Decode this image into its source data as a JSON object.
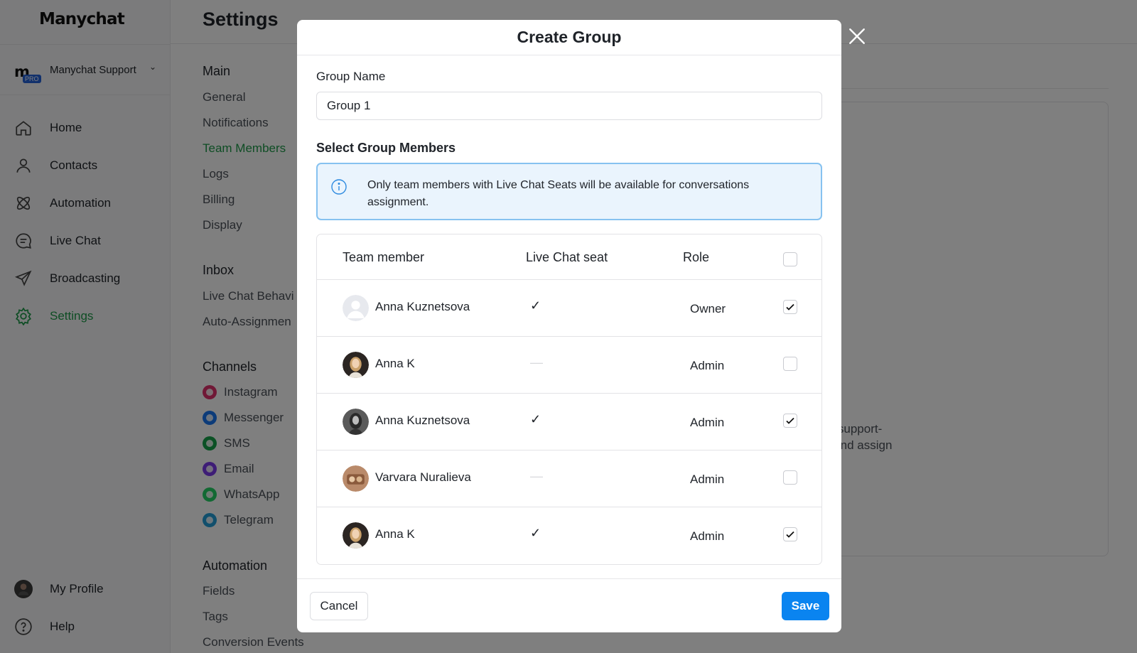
{
  "app": {
    "logo": "Manychat",
    "account": {
      "name": "Manychat Support",
      "badge": "PRO"
    },
    "nav": [
      {
        "label": "Home",
        "icon": "home-icon"
      },
      {
        "label": "Contacts",
        "icon": "user-icon"
      },
      {
        "label": "Automation",
        "icon": "automation-icon"
      },
      {
        "label": "Live Chat",
        "icon": "chat-icon"
      },
      {
        "label": "Broadcasting",
        "icon": "send-icon"
      },
      {
        "label": "Settings",
        "icon": "gear-icon",
        "active": true
      }
    ],
    "bottom_nav": [
      {
        "label": "My Profile",
        "icon": "profile-avatar"
      },
      {
        "label": "Help",
        "icon": "help-icon"
      }
    ],
    "page_title": "Settings",
    "settings_menu": {
      "main": {
        "heading": "Main",
        "items": [
          "General",
          "Notifications",
          "Team Members",
          "Logs",
          "Billing",
          "Display"
        ],
        "active": "Team Members"
      },
      "inbox": {
        "heading": "Inbox",
        "items": [
          "Live Chat Behavi",
          "Auto-Assignmen"
        ]
      },
      "channels": {
        "heading": "Channels",
        "items": [
          "Instagram",
          "Messenger",
          "SMS",
          "Email",
          "WhatsApp",
          "Telegram"
        ]
      },
      "automation": {
        "heading": "Automation",
        "items": [
          "Fields",
          "Tags",
          "Conversion Events"
        ]
      }
    },
    "background_text": {
      "line1": "e, support-",
      "line2": "k and assign"
    },
    "colors": {
      "accent_green": "#1d9b49",
      "primary_blue": "#0a84f0",
      "info_border": "#86c2f0",
      "info_bg": "#eaf4fd"
    }
  },
  "modal": {
    "title": "Create Group",
    "group_name_label": "Group Name",
    "group_name_value": "Group 1",
    "members_label": "Select Group Members",
    "info_text": "Only team members with Live Chat Seats will be available for conversations assignment.",
    "table": {
      "headers": {
        "member": "Team member",
        "seat": "Live Chat seat",
        "role": "Role"
      },
      "select_all_checked": false,
      "rows": [
        {
          "name": "Anna Kuznetsova",
          "seat": "✓",
          "has_seat": true,
          "role": "Owner",
          "checked": true,
          "avatar": "placeholder-avatar"
        },
        {
          "name": "Anna K",
          "seat": "—",
          "has_seat": false,
          "role": "Admin",
          "checked": false,
          "avatar": "photo-avatar"
        },
        {
          "name": "Anna Kuznetsova",
          "seat": "✓",
          "has_seat": true,
          "role": "Admin",
          "checked": true,
          "avatar": "photo-avatar"
        },
        {
          "name": "Varvara Nuralieva",
          "seat": "—",
          "has_seat": false,
          "role": "Admin",
          "checked": false,
          "avatar": "photo-avatar"
        },
        {
          "name": "Anna K",
          "seat": "✓",
          "has_seat": true,
          "role": "Admin",
          "checked": true,
          "avatar": "photo-avatar"
        }
      ]
    },
    "cancel_label": "Cancel",
    "save_label": "Save"
  }
}
